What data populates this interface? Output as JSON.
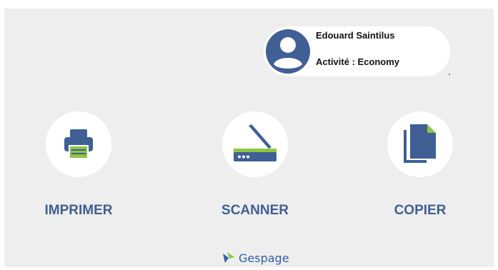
{
  "user": {
    "name": "Edouard Saintilus",
    "activity": "Activité : Economy"
  },
  "actions": [
    {
      "label": "IMPRIMER",
      "icon": "printer-icon"
    },
    {
      "label": "SCANNER",
      "icon": "scanner-icon"
    },
    {
      "label": "COPIER",
      "icon": "copy-icon"
    }
  ],
  "brand": {
    "name": "Gespage",
    "icon": "gespage-logo-icon"
  },
  "colors": {
    "accent": "#3f5f95",
    "green": "#8cc63f",
    "panel": "#eeeeee",
    "card": "#ffffff"
  }
}
